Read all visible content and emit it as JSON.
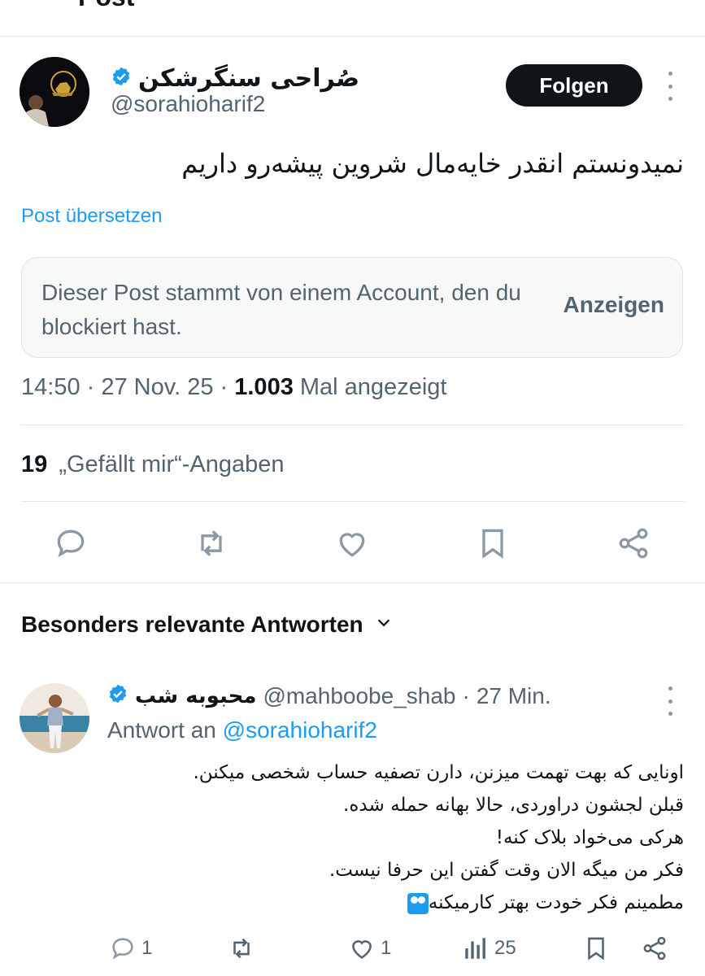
{
  "top_strip": {
    "partial_text": "Post"
  },
  "post": {
    "author_name": "صُراحی سنگرشکن",
    "handle": "@sorahioharif2",
    "follow_label": "Folgen",
    "text": "نمیدونستم انقدر خایه‌مال شروین پیشه‌رو داریم",
    "translate_label": "Post übersetzen",
    "blocked_notice": "Dieser Post stammt von einem Account, den du blockiert hast.",
    "show_label": "Anzeigen",
    "time": "14:50",
    "date": "27 Nov. 25",
    "views_count": "1.003",
    "views_label": "Mal angezeigt",
    "likes_count": "19",
    "likes_label": "„Gefällt mir“-Angaben",
    "actions": [
      "reply-icon",
      "repost-icon",
      "like-icon",
      "bookmark-icon",
      "share-icon"
    ]
  },
  "replies_section": {
    "title": "Besonders relevante Antworten"
  },
  "reply": {
    "author_name": "محبوبه شب",
    "handle": "@mahboobe_shab",
    "age": "27 Min.",
    "reply_to_prefix": "Antwort an",
    "reply_to_handle": "@sorahioharif2",
    "lines": [
      "اونایی که بهت تهمت میزنن، دارن تصفیه حساب شخصی میکنن.",
      "قبلن لجشون دراوردی، حالا بهانه حمله شده.",
      "هرکی می‌خواد بلاک کنه!",
      "فکر من میگه الان وقت گفتن این حرفا نیست.",
      "مطمینم فکر خودت بهتر کارمیکنه"
    ],
    "reply_count": "1",
    "like_count": "1",
    "view_count": "25"
  },
  "colors": {
    "accent": "#1d9bf0",
    "text": "#0f1419",
    "muted": "#536471",
    "verified": "#1d9bf0"
  }
}
